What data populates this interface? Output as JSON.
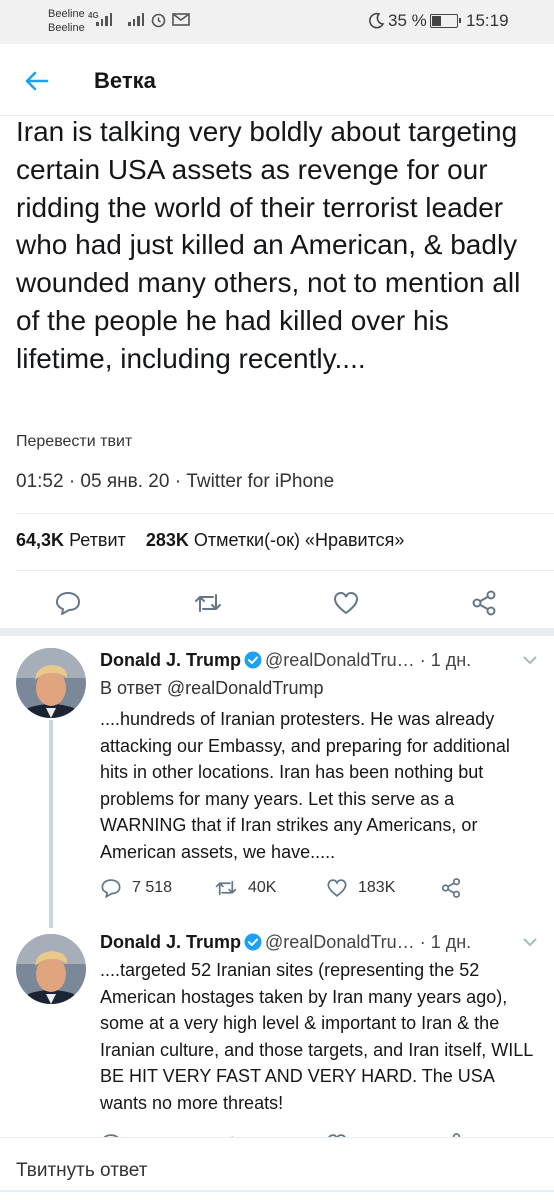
{
  "status_bar": {
    "carrier1": "Beeline",
    "carrier2": "Beeline",
    "network": "4G",
    "battery": "35 %",
    "time": "15:19"
  },
  "header": {
    "title": "Ветка"
  },
  "tweet": {
    "text": "Iran is talking very boldly about targeting certain USA assets as revenge for our ridding the world of their terrorist leader who had just killed an American, & badly wounded many others, not to mention all of the people he had killed over his lifetime, including recently....",
    "translate": "Перевести твит",
    "meta": "01:52 · 05 янв. 20 · Twitter for iPhone",
    "retweets_count": "64,3K",
    "retweets_label": "Ретвит",
    "likes_count": "283K",
    "likes_label": "Отметки(-ок) «Нравится»"
  },
  "replies": [
    {
      "name": "Donald J. Trump",
      "handle": "@realDonaldTru…",
      "time": "· 1 дн.",
      "reply_to": "В ответ @realDonaldTrump",
      "text": "....hundreds of Iranian protesters. He was already attacking our Embassy, and preparing for additional hits in other locations. Iran has been nothing but problems for many years. Let this serve as a WARNING that if Iran strikes any Americans, or American assets, we have.....",
      "replies": "7 518",
      "retweets": "40K",
      "likes": "183K"
    },
    {
      "name": "Donald J. Trump",
      "handle": "@realDonaldTru…",
      "time": "· 1 дн.",
      "text": "....targeted 52 Iranian sites (representing the 52 American hostages taken by Iran many years ago), some at a very high level & important to Iran &  the Iranian culture, and those targets, and Iran itself, WILL BE HIT VERY FAST AND VERY HARD. The USA wants no more threats!"
    }
  ],
  "compose": {
    "placeholder": "Твитнуть ответ"
  },
  "colors": {
    "accent": "#1da1f2",
    "divider": "#e6ecf0",
    "icon": "#657786"
  }
}
